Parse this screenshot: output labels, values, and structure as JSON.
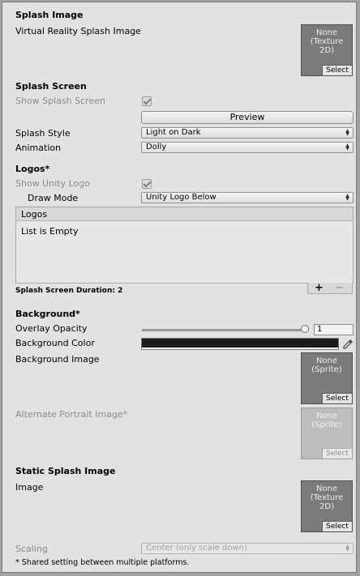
{
  "splash_image": {
    "header": "Splash Image",
    "vr_label": "Virtual Reality Splash Image",
    "vr_field": {
      "none_text": "None\n(Texture\n2D)",
      "select": "Select"
    }
  },
  "splash_screen": {
    "header": "Splash Screen",
    "show_label": "Show Splash Screen",
    "show_checked": true,
    "preview_button": "Preview",
    "style_label": "Splash Style",
    "style_value": "Light on Dark",
    "animation_label": "Animation",
    "animation_value": "Dolly"
  },
  "logos": {
    "header": "Logos*",
    "show_unity_logo_label": "Show Unity Logo",
    "show_unity_logo_checked": true,
    "draw_mode_label": "Draw Mode",
    "draw_mode_value": "Unity Logo Below",
    "list_header": "Logos",
    "list_empty": "List is Empty",
    "add_button": "+",
    "remove_button": "−",
    "duration_label": "Splash Screen Duration: 2"
  },
  "background": {
    "header": "Background*",
    "overlay_label": "Overlay Opacity",
    "overlay_value": "1",
    "overlay_fraction": 1,
    "color_label": "Background Color",
    "color_value": "#1c1c1c",
    "image_label": "Background Image",
    "image_field": {
      "none_text": "None\n(Sprite)",
      "select": "Select"
    },
    "portrait_label": "Alternate Portrait Image*",
    "portrait_field": {
      "none_text": "None\n(Sprite)",
      "select": "Select"
    }
  },
  "static_splash": {
    "header": "Static Splash Image",
    "image_label": "Image",
    "image_field": {
      "none_text": "None\n(Texture\n2D)",
      "select": "Select"
    },
    "scaling_label": "Scaling",
    "scaling_value": "Center (only scale down)"
  },
  "footnote": "* Shared setting between multiple platforms."
}
